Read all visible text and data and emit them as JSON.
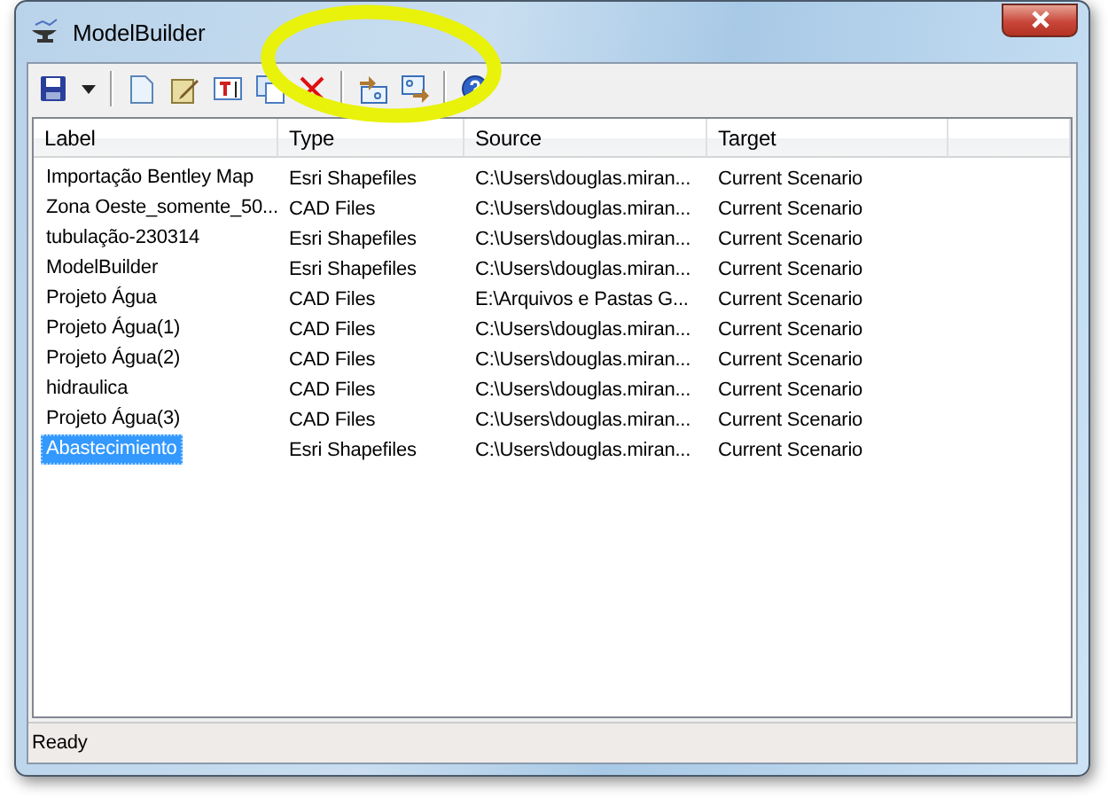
{
  "window": {
    "title": "ModelBuilder"
  },
  "toolbar": [
    {
      "kind": "save"
    },
    {
      "kind": "caret"
    },
    {
      "kind": "separator"
    },
    {
      "kind": "new"
    },
    {
      "kind": "edit"
    },
    {
      "kind": "rename"
    },
    {
      "kind": "duplicate"
    },
    {
      "kind": "delete"
    },
    {
      "kind": "separator"
    },
    {
      "kind": "import"
    },
    {
      "kind": "export"
    },
    {
      "kind": "separator"
    },
    {
      "kind": "help"
    }
  ],
  "annotation": {
    "kind": "circle",
    "color": "#e8f20a"
  },
  "table": {
    "columns": [
      "Label",
      "Type",
      "Source",
      "Target"
    ],
    "rows": [
      {
        "label": "Importação Bentley Map",
        "type": "Esri Shapefiles",
        "source": "C:\\Users\\douglas.miran...",
        "target": "Current Scenario",
        "selected": false
      },
      {
        "label": "Zona Oeste_somente_50...",
        "type": "CAD Files",
        "source": "C:\\Users\\douglas.miran...",
        "target": "Current Scenario",
        "selected": false
      },
      {
        "label": "tubulação-230314",
        "type": "Esri Shapefiles",
        "source": "C:\\Users\\douglas.miran...",
        "target": "Current Scenario",
        "selected": false
      },
      {
        "label": "ModelBuilder",
        "type": "Esri Shapefiles",
        "source": "C:\\Users\\douglas.miran...",
        "target": "Current Scenario",
        "selected": false
      },
      {
        "label": "Projeto Água",
        "type": "CAD Files",
        "source": "E:\\Arquivos e Pastas G...",
        "target": "Current Scenario",
        "selected": false
      },
      {
        "label": "Projeto Água(1)",
        "type": "CAD Files",
        "source": "C:\\Users\\douglas.miran...",
        "target": "Current Scenario",
        "selected": false
      },
      {
        "label": "Projeto Água(2)",
        "type": "CAD Files",
        "source": "C:\\Users\\douglas.miran...",
        "target": "Current Scenario",
        "selected": false
      },
      {
        "label": "hidraulica",
        "type": "CAD Files",
        "source": "C:\\Users\\douglas.miran...",
        "target": "Current Scenario",
        "selected": false
      },
      {
        "label": "Projeto Água(3)",
        "type": "CAD Files",
        "source": "C:\\Users\\douglas.miran...",
        "target": "Current Scenario",
        "selected": false
      },
      {
        "label": "Abastecimiento",
        "type": "Esri Shapefiles",
        "source": "C:\\Users\\douglas.miran...",
        "target": "Current Scenario",
        "selected": true
      }
    ]
  },
  "status_bar": "Ready"
}
